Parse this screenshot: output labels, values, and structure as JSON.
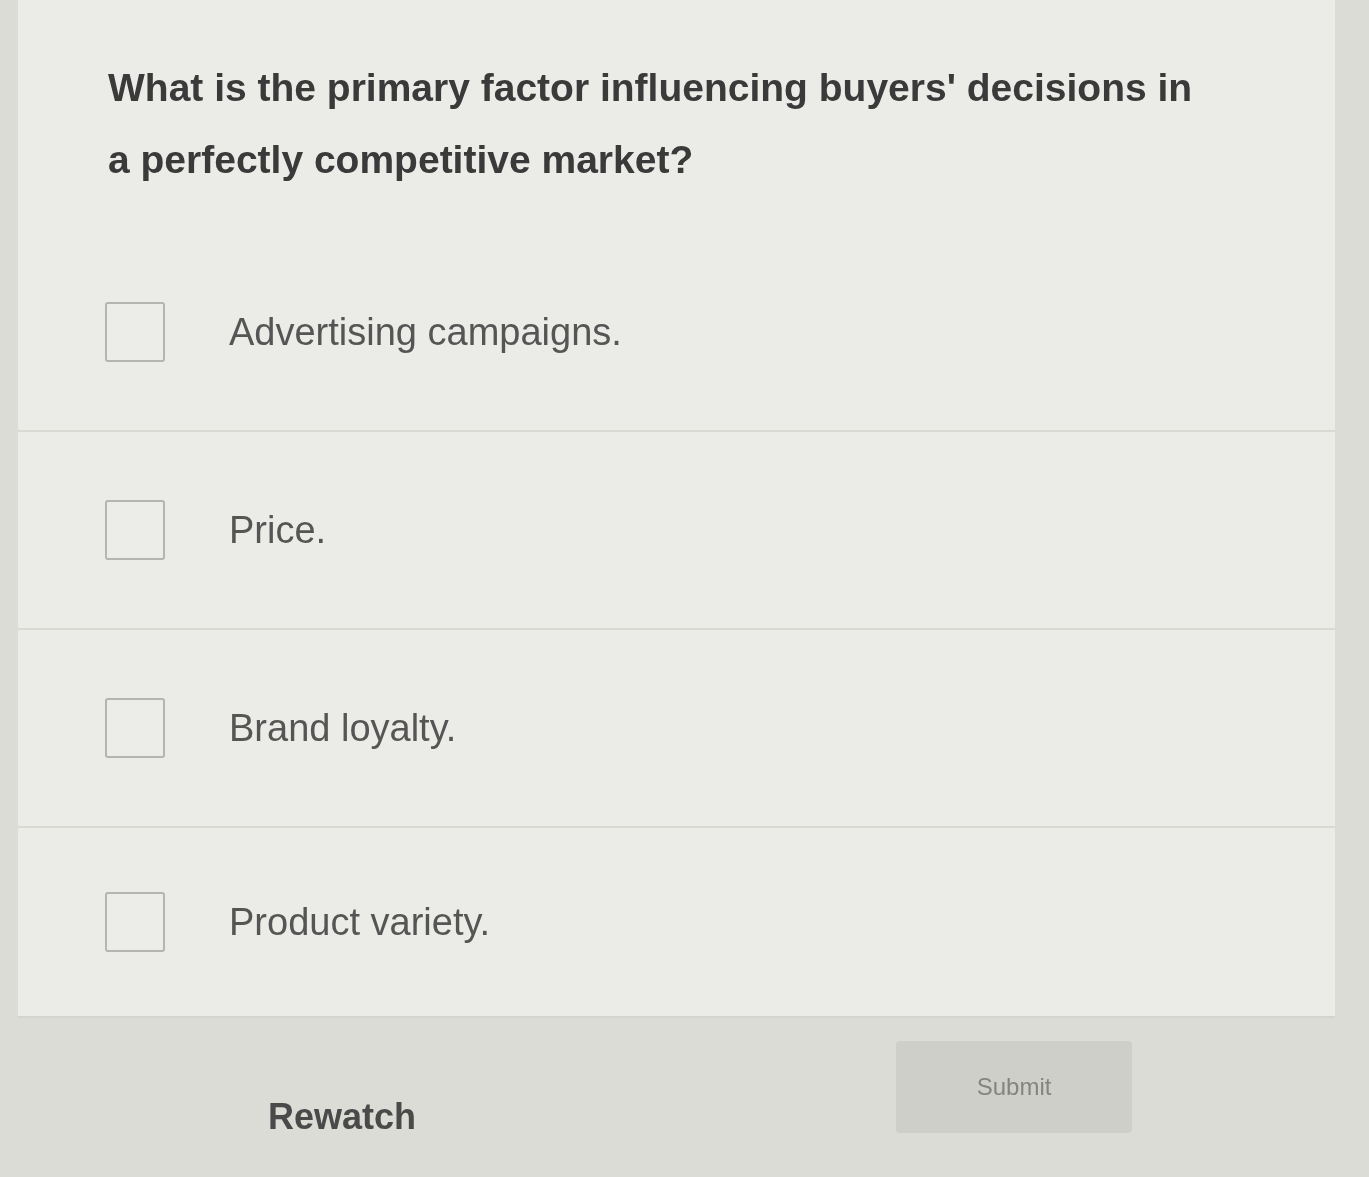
{
  "question": "What is the primary factor influencing buyers' decisions in a perfectly competitive market?",
  "options": [
    {
      "label": "Advertising campaigns.",
      "checked": false
    },
    {
      "label": "Price.",
      "checked": false
    },
    {
      "label": "Brand loyalty.",
      "checked": false
    },
    {
      "label": "Product variety.",
      "checked": false
    }
  ],
  "footer": {
    "rewatch": "Rewatch",
    "submit": {
      "label": "Submit",
      "disabled": true
    }
  }
}
